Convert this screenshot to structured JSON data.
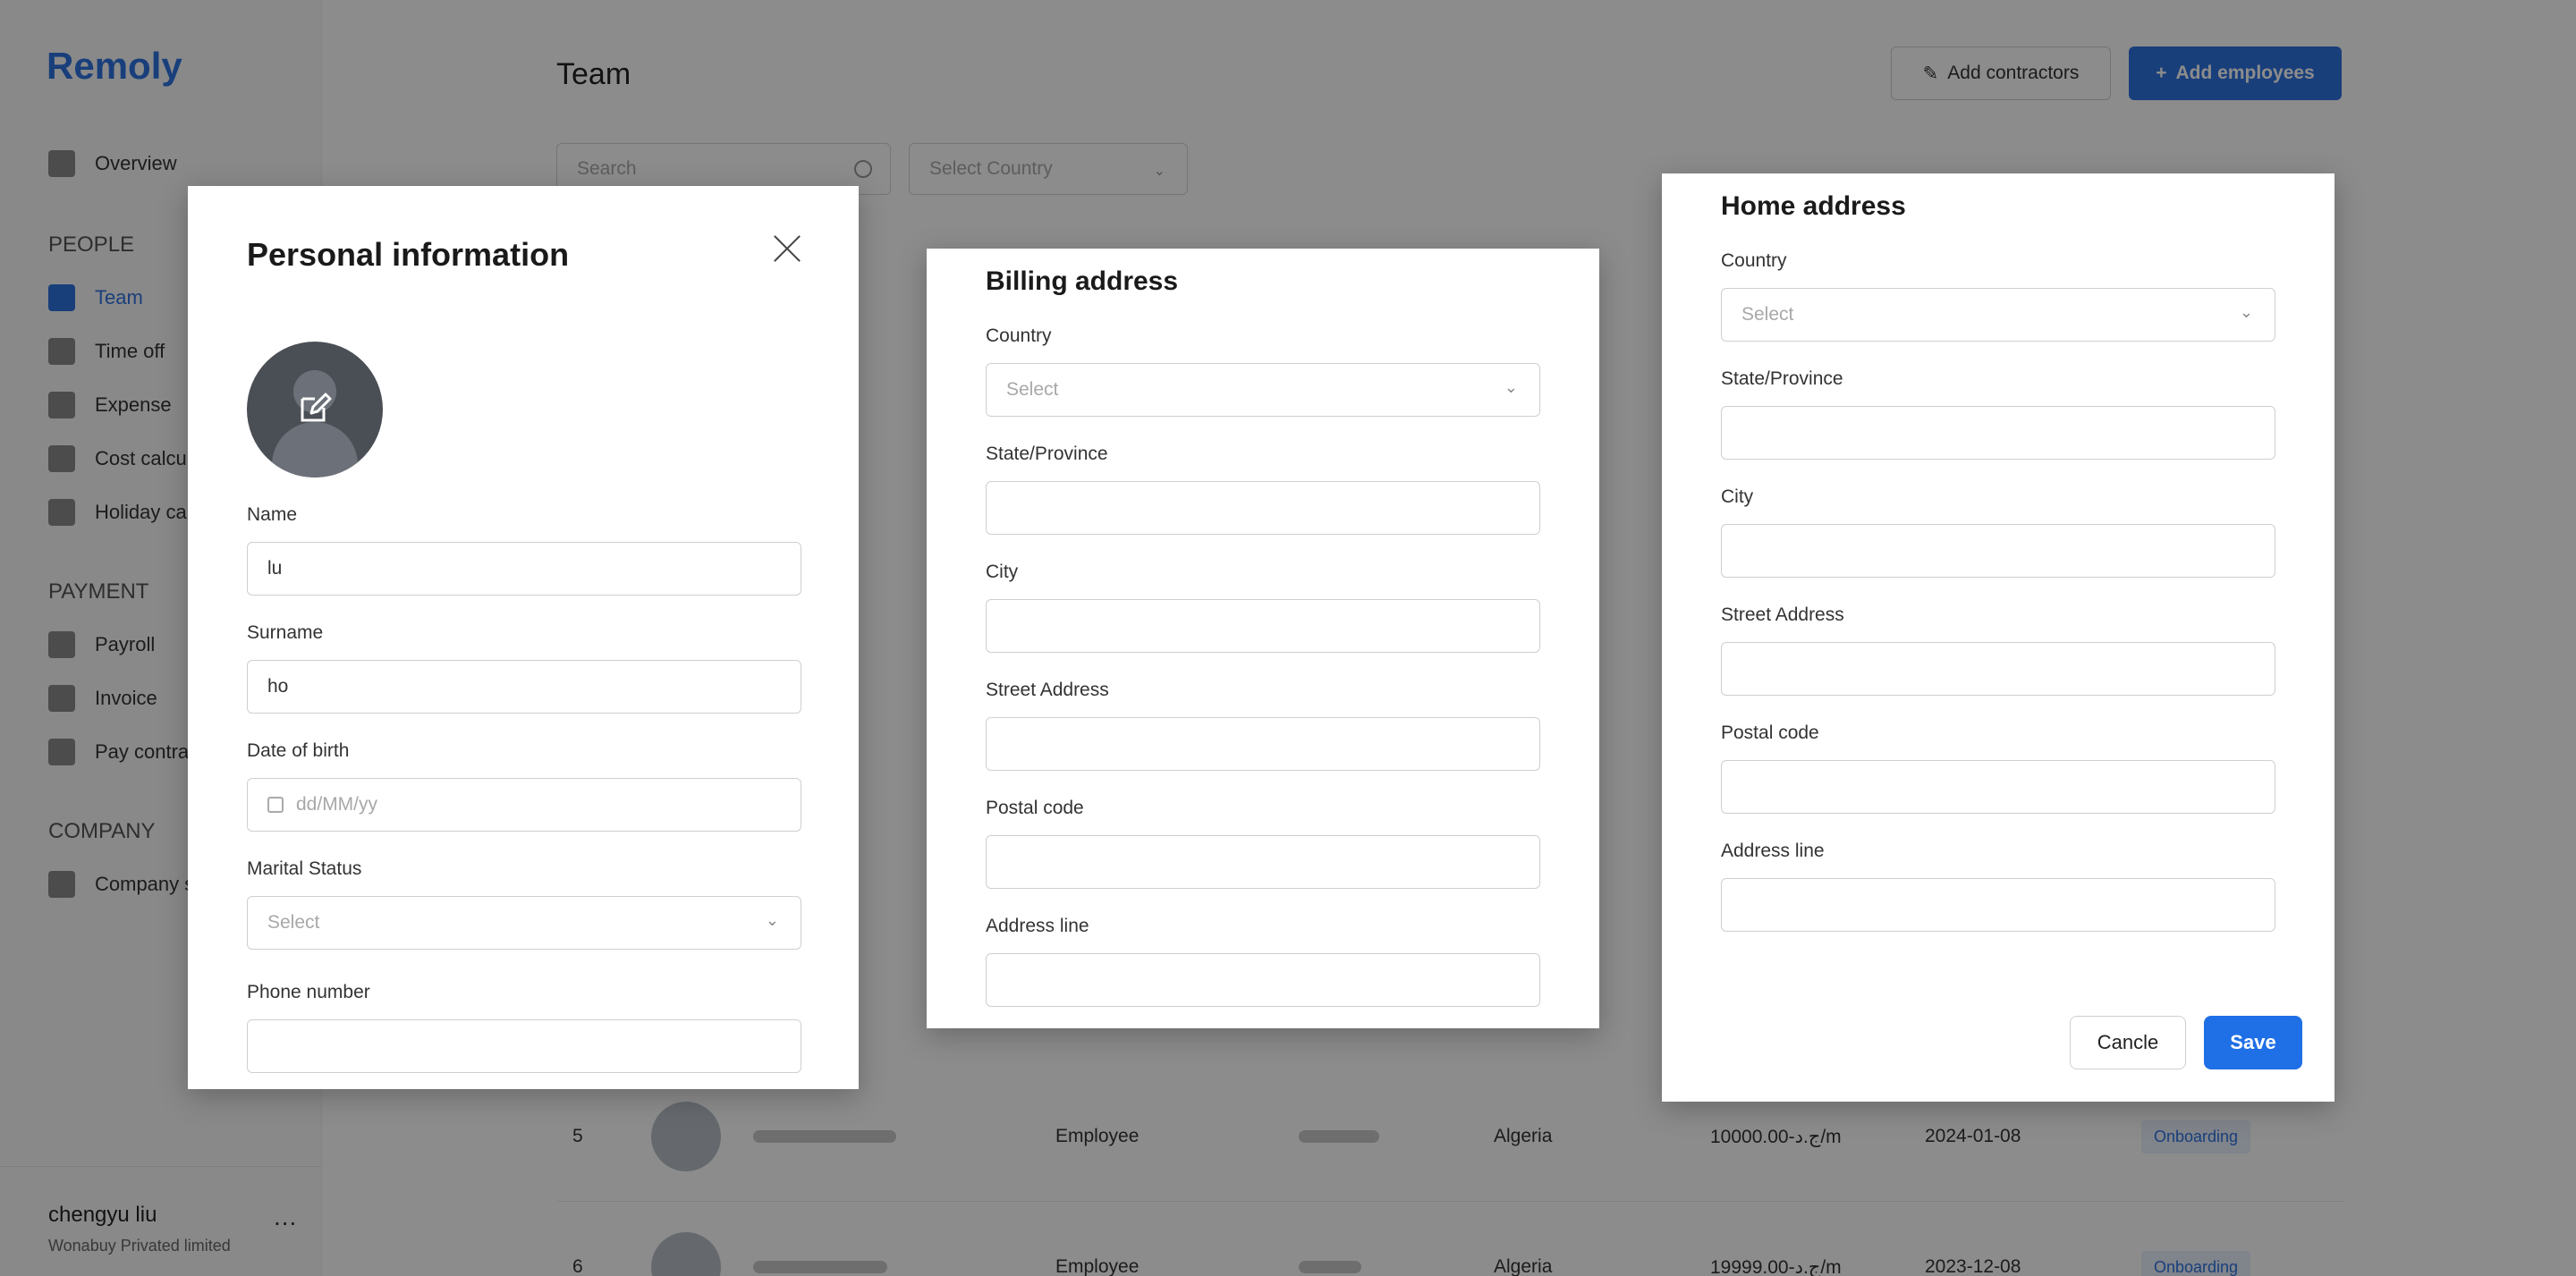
{
  "app": {
    "logo": "Remoly"
  },
  "sidebar": {
    "overview": "Overview",
    "sections": [
      "PEOPLE",
      "PAYMENT",
      "COMPANY"
    ],
    "people_items": [
      "Team",
      "Time off",
      "Expense",
      "Cost calcul",
      "Holiday ca"
    ],
    "payment_items": [
      "Payroll",
      "Invoice",
      "Pay contra"
    ],
    "company_items": [
      "Company s"
    ],
    "active": "Team"
  },
  "user": {
    "name": "chengyu liu",
    "org": "Wonabuy Privated limited",
    "more": "..."
  },
  "header": {
    "title": "Team",
    "add_contractors": "Add contractors",
    "add_employees": "Add employees"
  },
  "filters": {
    "search_placeholder": "Search",
    "country_placeholder": "Select Country"
  },
  "table": {
    "rows": [
      {
        "index": "5",
        "type": "Employee",
        "country": "Algeria",
        "salary": "ج.د-10000.00/m",
        "date": "2024-01-08",
        "status": "Onboarding"
      },
      {
        "index": "6",
        "type": "Employee",
        "country": "Algeria",
        "salary": "ج.د-19999.00/m",
        "date": "2023-12-08",
        "status": "Onboarding"
      }
    ]
  },
  "personal": {
    "title": "Personal information",
    "name_label": "Name",
    "name_value": "lu",
    "surname_label": "Surname",
    "surname_value": "ho",
    "dob_label": "Date of birth",
    "dob_placeholder": "dd/MM/yy",
    "marital_label": "Marital Status",
    "marital_placeholder": "Select",
    "phone_label": "Phone number"
  },
  "billing": {
    "title": "Billing address",
    "country_label": "Country",
    "country_placeholder": "Select",
    "state_label": "State/Province",
    "city_label": "City",
    "street_label": "Street Address",
    "postal_label": "Postal code",
    "address_line_label": "Address line"
  },
  "home": {
    "title": "Home address",
    "country_label": "Country",
    "country_placeholder": "Select",
    "state_label": "State/Province",
    "city_label": "City",
    "street_label": "Street Address",
    "postal_label": "Postal code",
    "address_line_label": "Address line",
    "cancel": "Cancle",
    "save": "Save"
  },
  "icons": [
    "grid-icon",
    "team-icon",
    "calendar-icon",
    "expense-icon",
    "calculator-icon",
    "payroll-icon",
    "invoice-icon",
    "card-icon",
    "building-icon",
    "search-icon",
    "chevron-down-icon",
    "close-icon",
    "edit-icon",
    "pen-icon",
    "plus-icon"
  ],
  "colors": {
    "accent": "#2f73e0",
    "save_button": "#1f6fe6",
    "overlay": "rgba(0,0,0,0.45)"
  }
}
